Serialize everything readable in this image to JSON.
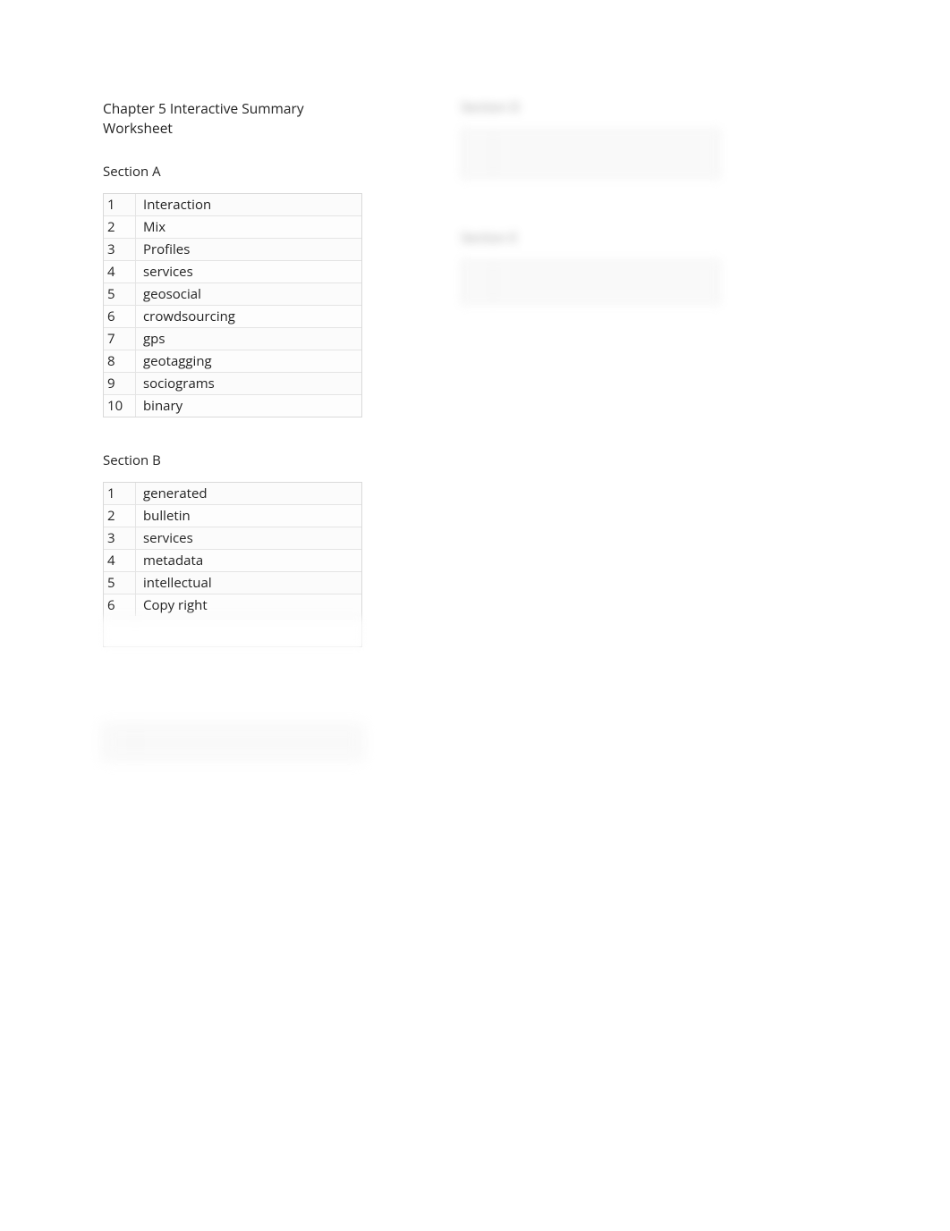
{
  "title": "Chapter 5 Interactive Summary Worksheet",
  "left": {
    "sectionA": {
      "heading": "Section A",
      "rows": [
        {
          "n": "1",
          "v": "Interaction"
        },
        {
          "n": "2",
          "v": "Mix"
        },
        {
          "n": "3",
          "v": "Profiles"
        },
        {
          "n": "4",
          "v": "services"
        },
        {
          "n": "5",
          "v": "geosocial"
        },
        {
          "n": "6",
          "v": "crowdsourcing"
        },
        {
          "n": "7",
          "v": "gps"
        },
        {
          "n": "8",
          "v": "geotagging"
        },
        {
          "n": "9",
          "v": "sociograms"
        },
        {
          "n": "10",
          "v": "binary"
        }
      ]
    },
    "sectionB": {
      "heading": "Section B",
      "rows_clear": [
        {
          "n": "1",
          "v": "generated"
        },
        {
          "n": "2",
          "v": "bulletin"
        },
        {
          "n": "3",
          "v": "services"
        },
        {
          "n": "4",
          "v": "metadata"
        },
        {
          "n": "5",
          "v": "intellectual"
        },
        {
          "n": "6",
          "v": "Copy right"
        }
      ],
      "rows_hidden": [
        {
          "n": "",
          "v": ""
        },
        {
          "n": "",
          "v": ""
        },
        {
          "n": "",
          "v": ""
        },
        {
          "n": "",
          "v": ""
        },
        {
          "n": "",
          "v": ""
        },
        {
          "n": "",
          "v": ""
        },
        {
          "n": "",
          "v": ""
        }
      ]
    },
    "float": {
      "rows": [
        {
          "n": "",
          "v": ""
        },
        {
          "n": "",
          "v": ""
        },
        {
          "n": "",
          "v": ""
        },
        {
          "n": "",
          "v": ""
        },
        {
          "n": "",
          "v": ""
        },
        {
          "n": "",
          "v": ""
        },
        {
          "n": "",
          "v": ""
        },
        {
          "n": "",
          "v": ""
        }
      ]
    }
  },
  "right": {
    "sectionD": {
      "heading": "Section D",
      "rows": [
        {
          "n": "",
          "v": ""
        },
        {
          "n": "",
          "v": ""
        },
        {
          "n": "",
          "v": ""
        },
        {
          "n": "",
          "v": ""
        },
        {
          "n": "",
          "v": ""
        },
        {
          "n": "",
          "v": ""
        },
        {
          "n": "",
          "v": ""
        },
        {
          "n": "",
          "v": ""
        },
        {
          "n": "",
          "v": ""
        },
        {
          "n": "",
          "v": ""
        },
        {
          "n": "",
          "v": ""
        }
      ]
    },
    "sectionE": {
      "heading": "Section E",
      "rows": [
        {
          "n": "",
          "v": ""
        },
        {
          "n": "",
          "v": ""
        },
        {
          "n": "",
          "v": ""
        },
        {
          "n": "",
          "v": ""
        },
        {
          "n": "",
          "v": ""
        },
        {
          "n": "",
          "v": ""
        },
        {
          "n": "",
          "v": ""
        },
        {
          "n": "",
          "v": ""
        },
        {
          "n": "",
          "v": ""
        },
        {
          "n": "",
          "v": ""
        }
      ]
    }
  }
}
